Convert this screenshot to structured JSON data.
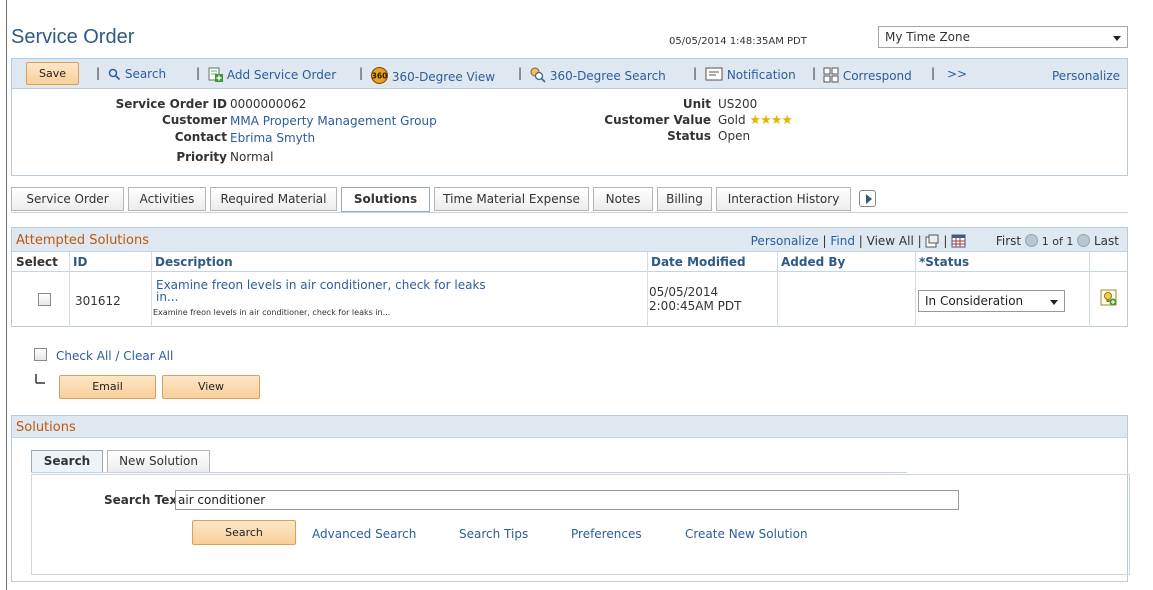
{
  "header": {
    "title": "Service Order",
    "timestamp": "05/05/2014 1:48:35AM PDT",
    "timezone": "My Time Zone"
  },
  "toolbar": {
    "save": "Save",
    "search": "Search",
    "add_service_order": "Add Service Order",
    "view_360": "360-Degree View",
    "search_360": "360-Degree Search",
    "notification": "Notification",
    "correspond": "Correspond",
    "more": ">>",
    "personalize": "Personalize",
    "sep": "|"
  },
  "summary": {
    "service_order_id_label": "Service Order ID",
    "service_order_id": "0000000062",
    "customer_label": "Customer",
    "customer": "MMA Property Management Group",
    "contact_label": "Contact",
    "contact": "Ebrima Smyth",
    "priority_label": "Priority",
    "priority": "Normal",
    "unit_label": "Unit",
    "unit": "US200",
    "customer_value_label": "Customer Value",
    "customer_value": "Gold",
    "customer_value_stars": "★★★★",
    "status_label": "Status",
    "status": "Open"
  },
  "tabs": [
    {
      "label": "Service Order"
    },
    {
      "label": "Activities"
    },
    {
      "label": "Required Material"
    },
    {
      "label": "Solutions"
    },
    {
      "label": "Time Material Expense"
    },
    {
      "label": "Notes"
    },
    {
      "label": "Billing"
    },
    {
      "label": "Interaction History"
    }
  ],
  "grid": {
    "title": "Attempted Solutions",
    "personalize": "Personalize",
    "find": "Find",
    "view_all": "View All",
    "first": "First",
    "range": "1 of 1",
    "last": "Last",
    "columns": {
      "select": "Select",
      "id": "ID",
      "description": "Description",
      "date_modified": "Date Modified",
      "added_by": "Added By",
      "status": "*Status"
    },
    "rows": [
      {
        "id": "301612",
        "description_title": "Examine freon levels in air conditioner, check for leaks in...",
        "description_sub": "Examine freon levels in air conditioner, check for leaks in...",
        "date_line1": "05/05/2014",
        "date_line2": "2:00:45AM PDT",
        "added_by": "",
        "status": "In Consideration"
      }
    ]
  },
  "actions": {
    "check_all": "Check All / Clear All",
    "email": "Email",
    "view": "View"
  },
  "solutions": {
    "title": "Solutions",
    "tab_search": "Search",
    "tab_new": "New Solution",
    "search_text_label": "Search Text",
    "search_text_value": "air conditioner",
    "search_button": "Search",
    "links": {
      "advanced": "Advanced Search",
      "tips": "Search Tips",
      "preferences": "Preferences",
      "create": "Create New Solution"
    }
  }
}
